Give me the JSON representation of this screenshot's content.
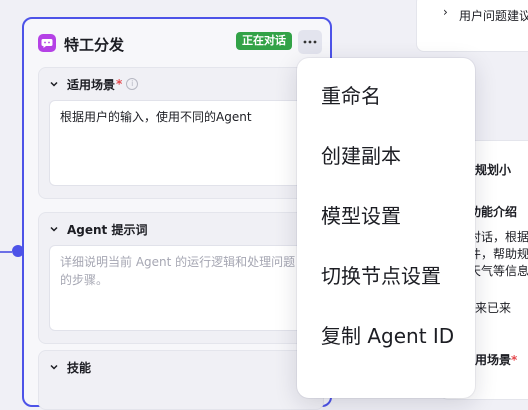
{
  "node": {
    "title": "特工分发",
    "status": "正在对话",
    "sections": {
      "scenario": {
        "label": "适用场景",
        "required_mark": "*",
        "info": "i",
        "value": "根据用户的输入，使用不同的Agent"
      },
      "prompt": {
        "label": "Agent 提示词",
        "placeholder": "详细说明当前 Agent 的运行逻辑和处理问题的步骤。"
      },
      "skills": {
        "label": "技能"
      }
    }
  },
  "context_menu": {
    "items": [
      "重命名",
      "创建副本",
      "模型设置",
      "切换节点设置",
      "复制 Agent ID"
    ]
  },
  "background_panels": {
    "top_row": "用户问题建议",
    "agent_title": "差规划小",
    "intro_label": "功能介绍",
    "intro_line1": "对话，根据",
    "intro_line2": "件，帮助规",
    "intro_line3": "天气等信息",
    "partial_text": "来已来",
    "scenario_label": "用场景",
    "required_mark": "*"
  },
  "colors": {
    "accent": "#4d53e8",
    "status_green": "#32a247",
    "agent_icon": "#b541e6"
  }
}
